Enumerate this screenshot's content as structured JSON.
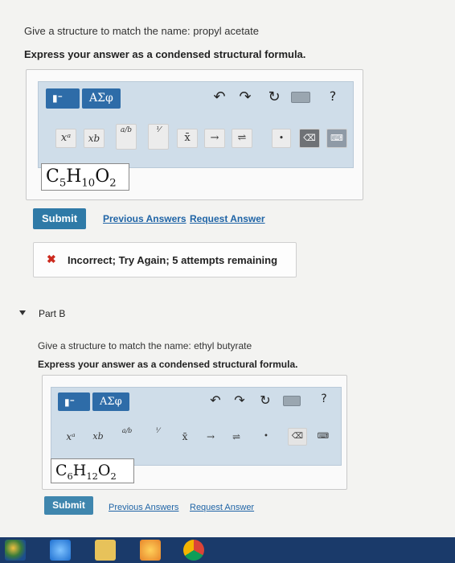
{
  "part_a": {
    "prompt": "Give a structure to match the name: propyl acetate",
    "instruction": "Express your answer as a condensed structural formula.",
    "answer": {
      "c": "C",
      "c_sub": "5",
      "h": "H",
      "h_sub": "10",
      "o": "O",
      "o_sub": "2"
    },
    "submit_label": "Submit",
    "previous_answers_label": "Previous Answers",
    "request_answer_label": "Request Answer",
    "feedback_icon": "✖",
    "feedback_text": "Incorrect; Try Again; 5 attempts remaining"
  },
  "part_b": {
    "title": "Part B",
    "prompt": "Give a structure to match the name: ethyl butyrate",
    "instruction": "Express your answer as a condensed structural formula.",
    "answer": {
      "c": "C",
      "c_sub": "6",
      "h": "H",
      "h_sub": "12",
      "o": "O",
      "o_sub": "2"
    },
    "submit_label": "Submit",
    "previous_answers_label": "Previous Answers",
    "request_answer_label": "Request Answer"
  },
  "toolbar": {
    "greek_label": "ΑΣφ",
    "help_label": "?",
    "superscript_label": "xᵃ",
    "subscript_label": "xb",
    "fraction_label": "a/b",
    "xbar_label": "x̄",
    "arrow_label": "→",
    "equilibrium_label": "⇌",
    "dot_label": "•"
  },
  "colors": {
    "toolbar_bg": "#cfdde9",
    "template_button": "#2e6ca8",
    "submit_button": "#2f7aa7",
    "link": "#1f64a6",
    "error": "#cc2a1e"
  }
}
